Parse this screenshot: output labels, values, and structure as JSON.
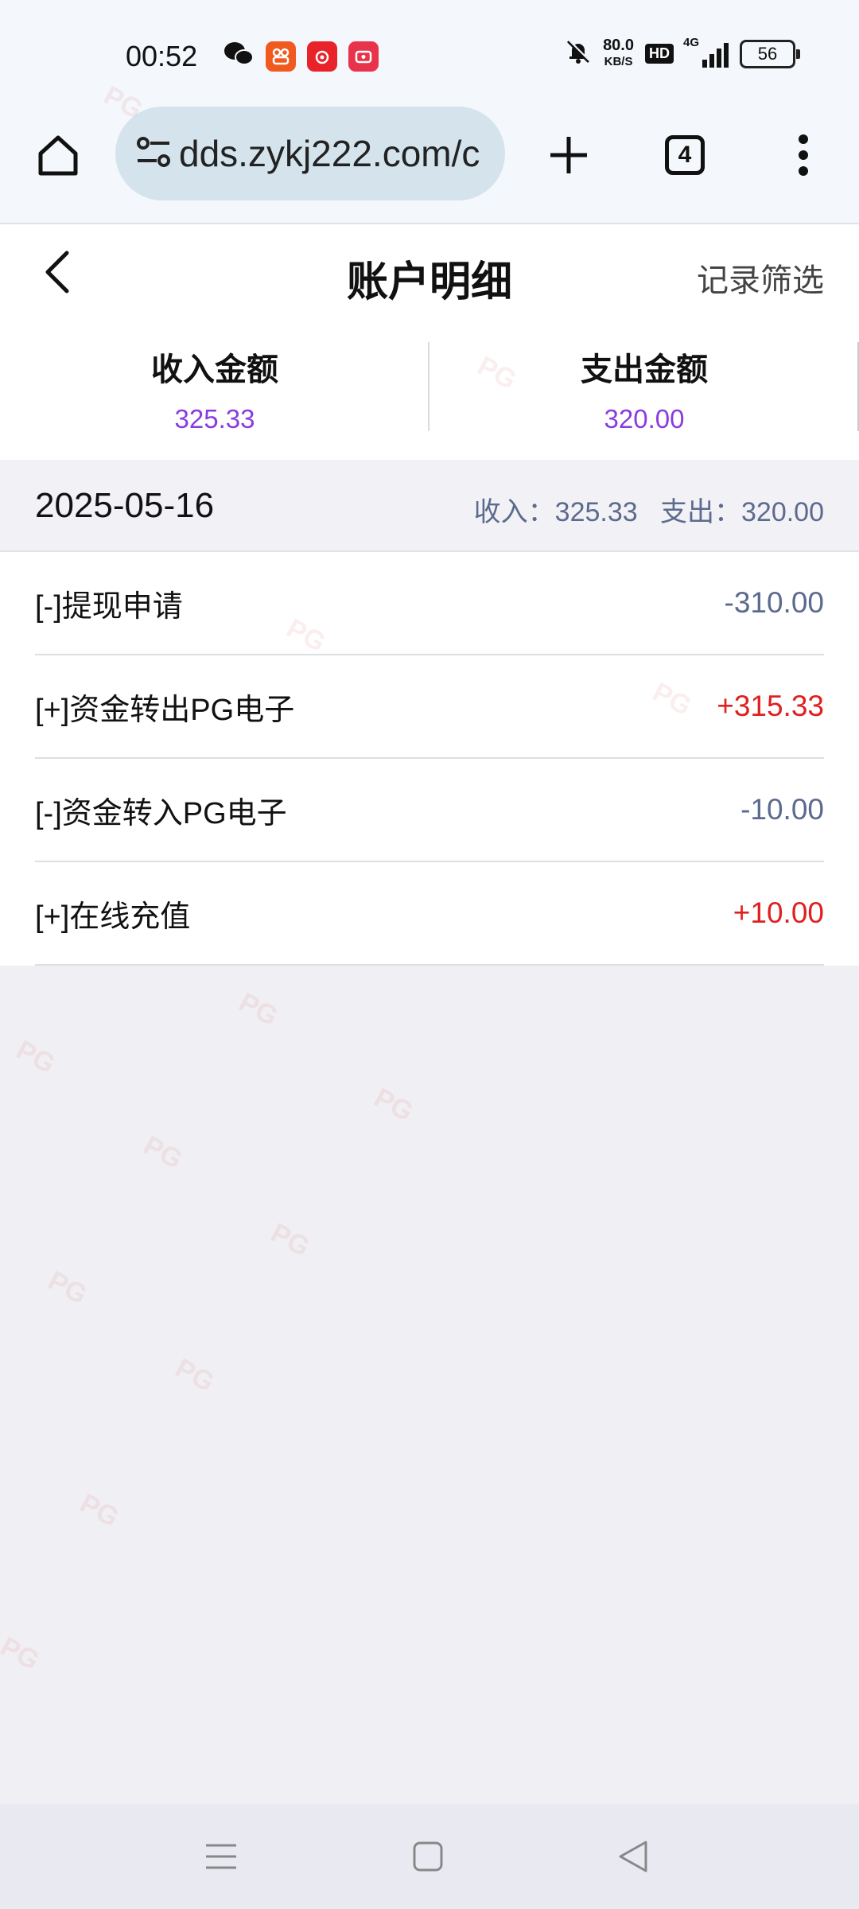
{
  "status_bar": {
    "time": "00:52",
    "net_speed_value": "80.0",
    "net_speed_unit": "KB/S",
    "hd_badge": "HD",
    "network": "4G",
    "battery": "56"
  },
  "browser": {
    "url": "dds.zykj222.com/c",
    "tab_count": "4"
  },
  "header": {
    "title": "账户明细",
    "filter_label": "记录筛选"
  },
  "summary": {
    "income_label": "收入金额",
    "income_value": "325.33",
    "expense_label": "支出金额",
    "expense_value": "320.00"
  },
  "date_group": {
    "date": "2025-05-16",
    "summary_text": "收入：325.33   支出：320.00"
  },
  "transactions": [
    {
      "title": "[-]提现申请",
      "amount": "-310.00"
    },
    {
      "title": "[+]资金转出PG电子",
      "amount": "+315.33"
    },
    {
      "title": "[-]资金转入PG电子",
      "amount": "-10.00"
    },
    {
      "title": "[+]在线充值",
      "amount": "+10.00"
    }
  ],
  "watermark_text": "PG",
  "colors": {
    "accent_purple": "#8a3be0",
    "positive_red": "#e02020",
    "negative_slate": "#5c6a8e"
  },
  "icons": {
    "home": "home-icon",
    "site_settings": "tune-icon",
    "new_tab": "plus-icon",
    "tab_switcher": "tabs-icon",
    "overflow": "more-vertical-icon",
    "back": "chevron-left-icon",
    "nav_menu": "menu-icon",
    "nav_home": "square-icon",
    "nav_back": "triangle-back-icon"
  }
}
